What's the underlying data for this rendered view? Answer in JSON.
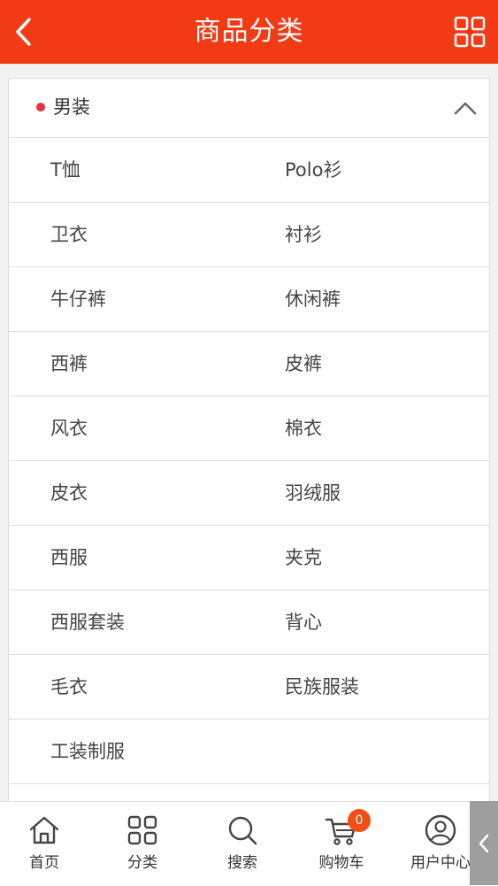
{
  "header": {
    "title": "商品分类",
    "back_icon": "chevron-left-icon",
    "menu_icon": "grid-icon",
    "background": "#f23a14"
  },
  "category": {
    "title": "男装",
    "dot_color": "#e8323c",
    "rows": [
      [
        "T恤",
        "Polo衫"
      ],
      [
        "卫衣",
        "衬衫"
      ],
      [
        "牛仔裤",
        "休闲裤"
      ],
      [
        "西裤",
        "皮裤"
      ],
      [
        "风衣",
        "棉衣"
      ],
      [
        "皮衣",
        "羽绒服"
      ],
      [
        "西服",
        "夹克"
      ],
      [
        "西服套装",
        "背心"
      ],
      [
        "毛衣",
        "民族服装"
      ],
      [
        "工装制服",
        ""
      ]
    ]
  },
  "tabbar": {
    "tabs": [
      {
        "label": "首页",
        "icon": "home-icon"
      },
      {
        "label": "分类",
        "icon": "category-icon"
      },
      {
        "label": "搜索",
        "icon": "search-icon"
      },
      {
        "label": "购物车",
        "icon": "cart-icon"
      },
      {
        "label": "用户中心",
        "icon": "user-icon"
      }
    ],
    "cart_count": "0",
    "badge_color": "#f24d17"
  }
}
